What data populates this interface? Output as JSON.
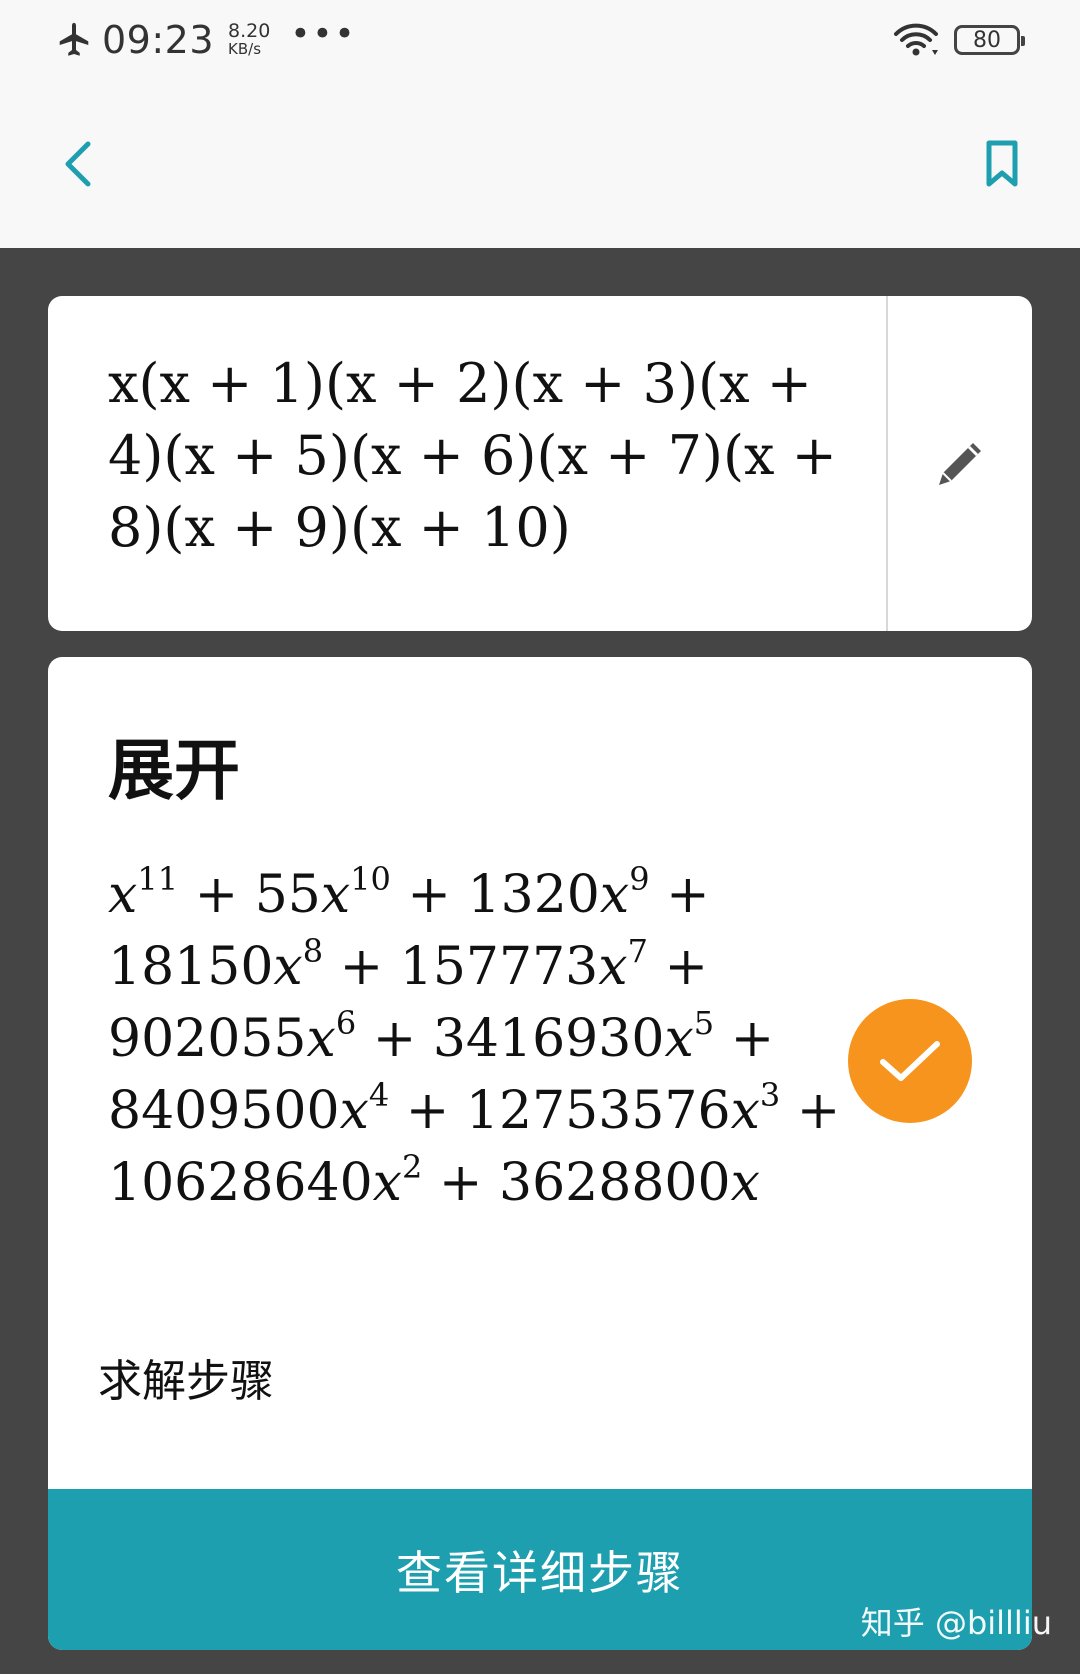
{
  "status_bar": {
    "time": "09:23",
    "net_speed_value": "8.20",
    "net_speed_unit": "KB/s",
    "more": "•••",
    "battery_level": "80"
  },
  "app_bar": {
    "back_icon": "chevron-left-icon",
    "bookmark_icon": "bookmark-icon",
    "accent_color": "#1e9faf"
  },
  "problem": {
    "lines": [
      "x(x + 1)(x + 2)(x + 3)(x +",
      "4)(x + 5)(x + 6)(x + 7)(x +",
      "8)(x + 9)(x + 10)"
    ],
    "edit_icon": "pencil-icon"
  },
  "result": {
    "title": "展开",
    "terms": [
      {
        "coef": "",
        "exp": "11"
      },
      {
        "coef": "55",
        "exp": "10"
      },
      {
        "coef": "1320",
        "exp": "9"
      },
      {
        "coef": "18150",
        "exp": "8"
      },
      {
        "coef": "157773",
        "exp": "7"
      },
      {
        "coef": "902055",
        "exp": "6"
      },
      {
        "coef": "3416930",
        "exp": "5"
      },
      {
        "coef": "8409500",
        "exp": "4"
      },
      {
        "coef": "12753576",
        "exp": "3"
      },
      {
        "coef": "10628640",
        "exp": "2"
      },
      {
        "coef": "3628800",
        "exp": ""
      }
    ],
    "status_icon": "check-icon",
    "status_color": "#f7941d"
  },
  "steps": {
    "label": "求解步骤",
    "button_label": "查看详细步骤"
  },
  "watermark": "知乎 @billliu"
}
